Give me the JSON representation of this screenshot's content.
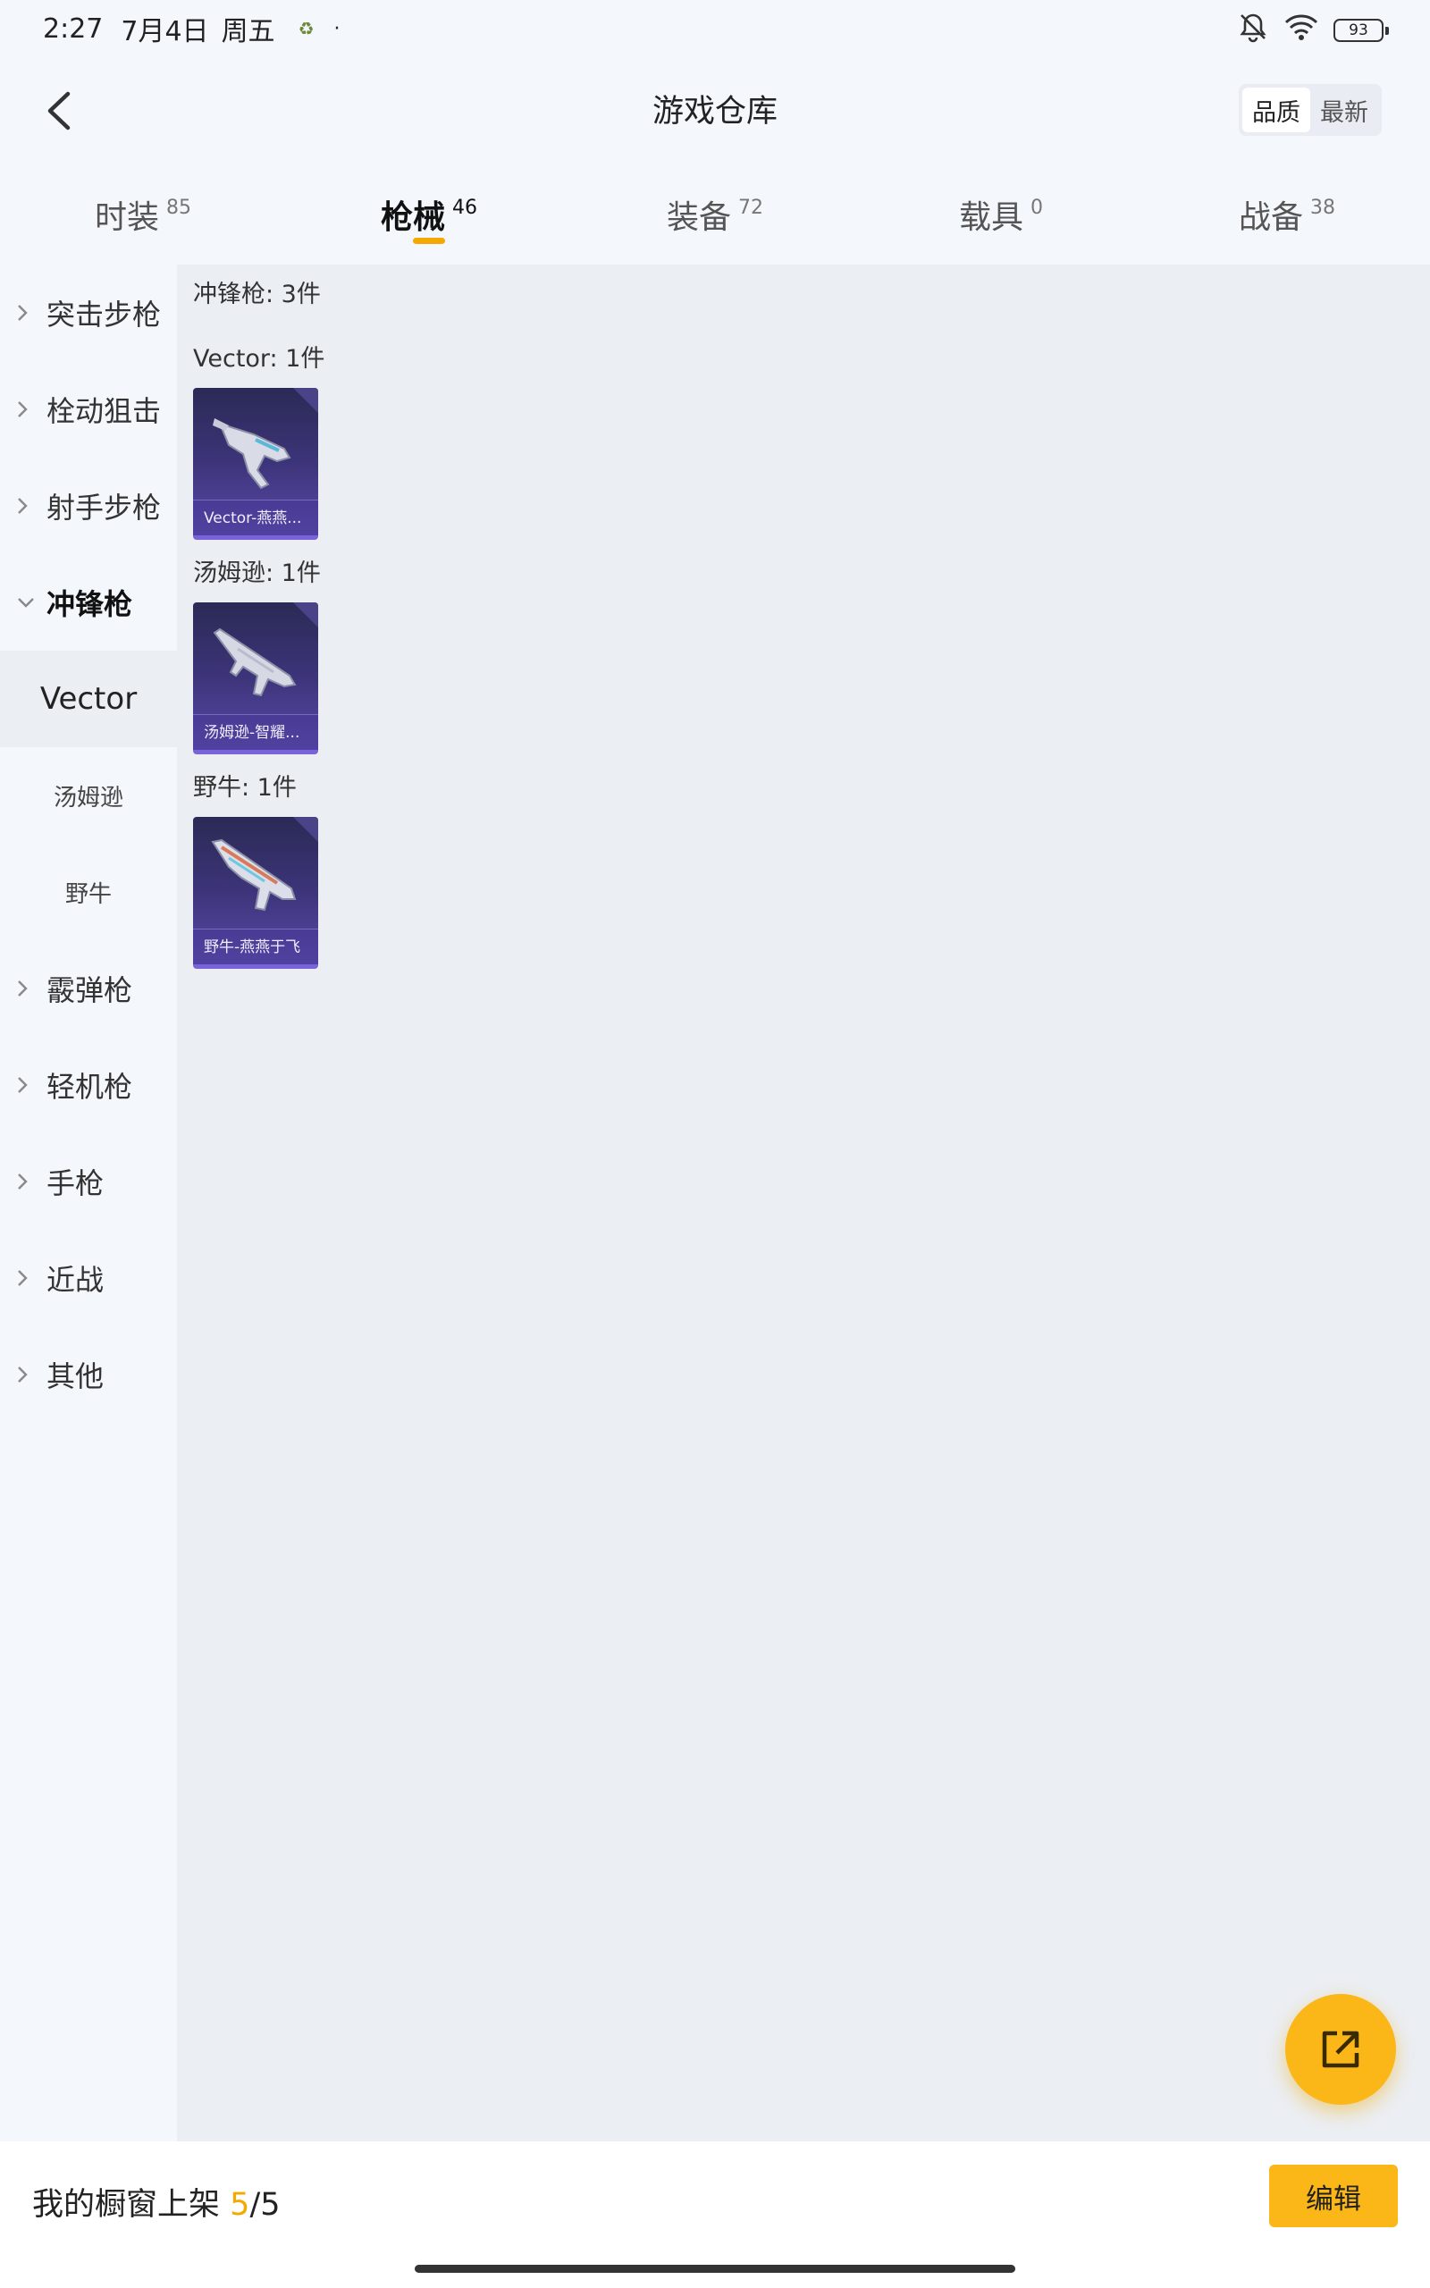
{
  "status_bar": {
    "time": "2:27",
    "date": "7月4日",
    "weekday": "周五",
    "battery": "93",
    "icons": [
      "app-notification-icon",
      "mute-icon",
      "wifi-icon",
      "battery-icon"
    ]
  },
  "header": {
    "title": "游戏仓库",
    "sort_options": [
      "品质",
      "最新"
    ],
    "sort_selected": "品质"
  },
  "tabs": [
    {
      "label": "时装",
      "count": "85"
    },
    {
      "label": "枪械",
      "count": "46",
      "active": true
    },
    {
      "label": "装备",
      "count": "72"
    },
    {
      "label": "载具",
      "count": "0"
    },
    {
      "label": "战备",
      "count": "38"
    }
  ],
  "sidebar": {
    "items": [
      "突击步枪",
      "栓动狙击",
      "射手步枪",
      "冲锋枪",
      "霰弹枪",
      "轻机枪",
      "手枪",
      "近战",
      "其他"
    ],
    "expanded": "冲锋枪",
    "subitems": [
      "Vector",
      "汤姆逊",
      "野牛"
    ],
    "selected_subitem": "Vector"
  },
  "content": {
    "category_total": "冲锋枪: 3件",
    "groups": [
      {
        "title": "Vector: 1件",
        "items": [
          {
            "name": "Vector-燕燕..."
          }
        ]
      },
      {
        "title": "汤姆逊: 1件",
        "items": [
          {
            "name": "汤姆逊-智耀..."
          }
        ]
      },
      {
        "title": "野牛: 1件",
        "items": [
          {
            "name": "野牛-燕燕于飞"
          }
        ]
      }
    ]
  },
  "bottom_bar": {
    "label": "我的橱窗上架",
    "used": "5",
    "total": "/5",
    "edit_button": "编辑"
  },
  "colors": {
    "accent": "#f5a800",
    "fab": "#fbb617",
    "card_bg": "#3c3479",
    "content_bg": "#ebeef3",
    "page_bg": "#f4f7fc"
  }
}
